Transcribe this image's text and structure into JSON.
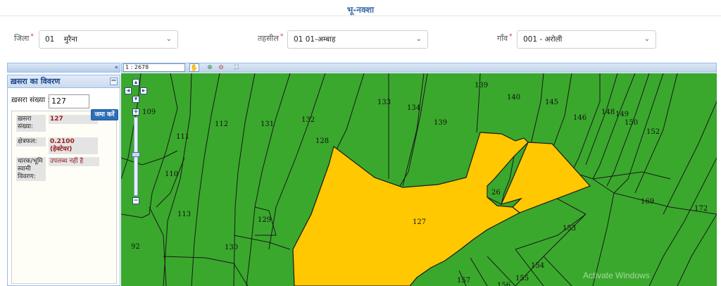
{
  "header": {
    "title": "भू-नक्शा"
  },
  "filters": {
    "district": {
      "label": "जिला",
      "required": "*",
      "value_code": "01",
      "value_name": "मुरैना"
    },
    "tehsil": {
      "label": "तहसील",
      "required": "*",
      "value": "01 01-अम्बाह"
    },
    "village": {
      "label": "गाँव",
      "required": "*",
      "value": "001 - अरोली"
    }
  },
  "panel": {
    "collapse_symbol": "«",
    "title": "ख़सरा का विवरण",
    "minimize_symbol": "−",
    "khasra_label": "ख़सरा संख्या :",
    "khasra_input_value": "127",
    "submit_label": "जमा करें",
    "details": {
      "khasra_label": "ख़सरा संख्या:",
      "khasra_value": "127",
      "area_label": "क्षेत्रफल:",
      "area_value": "0.2100",
      "area_unit": "(हेक्टेयर)",
      "owner_label": "धारक/भूमि स्वामी विवरण:",
      "owner_value": "उपलब्ध नहीं है"
    }
  },
  "map": {
    "scale": "1 : 2678",
    "colors": {
      "parcel": "#3aa82d",
      "selected": "#ffc800",
      "border": "#1a1a1a"
    },
    "selected_parcel": "127",
    "parcel_labels": [
      "109",
      "111",
      "112",
      "131",
      "132",
      "133",
      "134",
      "139",
      "139",
      "140",
      "145",
      "146",
      "148",
      "149",
      "150",
      "152",
      "128",
      "110",
      "113",
      "129",
      "130",
      "92",
      "26",
      "169",
      "172",
      "153",
      "154",
      "155",
      "157",
      "156",
      "127"
    ],
    "watermark": "Activate Windows"
  }
}
